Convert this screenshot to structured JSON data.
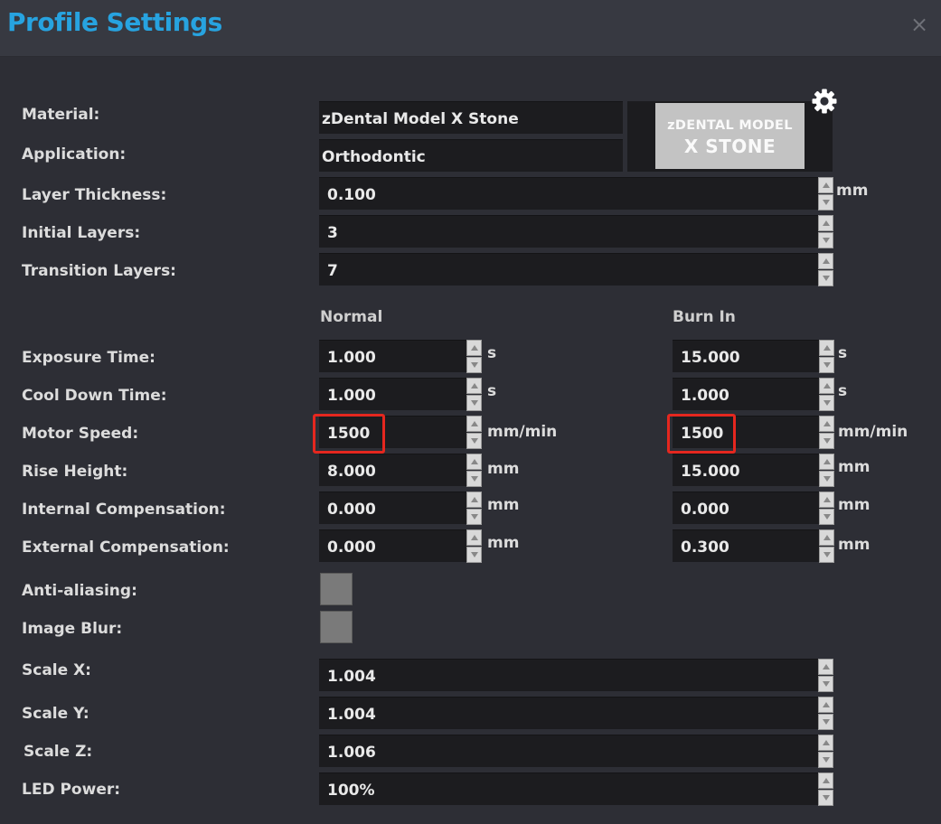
{
  "window": {
    "title": "Profile Settings",
    "close_glyph": "×"
  },
  "labels": {
    "material": "Material:",
    "application": "Application:",
    "layer_thickness": "Layer Thickness:",
    "initial_layers": "Initial Layers:",
    "transition_layers": "Transition Layers:",
    "exposure_time": "Exposure Time:",
    "cool_down_time": "Cool Down Time:",
    "motor_speed": "Motor Speed:",
    "rise_height": "Rise Height:",
    "internal_compensation": "Internal Compensation:",
    "external_compensation": "External Compensation:",
    "anti_aliasing": "Anti-aliasing:",
    "image_blur": "Image Blur:",
    "scale_x": "Scale X:",
    "scale_y": "Scale Y:",
    "scale_z": "Scale Z:",
    "led_power": "LED Power:"
  },
  "columns": {
    "normal": "Normal",
    "burn_in": "Burn In"
  },
  "values": {
    "material": "zDental Model X Stone",
    "application": "Orthodontic",
    "layer_thickness": "0.100",
    "initial_layers": "3",
    "transition_layers": "7",
    "scale_x": "1.004",
    "scale_y": "1.004",
    "scale_z": "1.006",
    "led_power": "100%"
  },
  "normal": {
    "exposure_time": "1.000",
    "cool_down_time": "1.000",
    "motor_speed": "1500",
    "rise_height": "8.000",
    "internal_compensation": "0.000",
    "external_compensation": "0.000"
  },
  "burn_in": {
    "exposure_time": "15.000",
    "cool_down_time": "1.000",
    "motor_speed": "1500",
    "rise_height": "15.000",
    "internal_compensation": "0.000",
    "external_compensation": "0.300"
  },
  "units": {
    "mm": "mm",
    "s": "s",
    "mm_per_min": "mm/min"
  },
  "checkboxes": {
    "anti_aliasing": false,
    "image_blur": false
  },
  "logo": {
    "line1": "zDENTAL MODEL",
    "line2": "X STONE"
  },
  "icons": {
    "settings": "gear-icon",
    "close": "close-icon"
  },
  "colors": {
    "title": "#27a3e0",
    "background": "#2d2e35",
    "titlebar": "#373941",
    "field": "#1c1c1f",
    "highlight": "#e5271f"
  }
}
